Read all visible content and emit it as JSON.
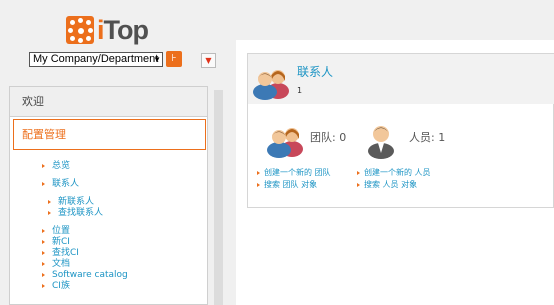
{
  "logo": {
    "mark_icon": "itop-logo-mark",
    "text_i": "i",
    "text_rest": "Top"
  },
  "org_selector": {
    "value": "My Company/Department",
    "icon": "chevron-down-icon"
  },
  "org_button": {
    "icon": "hierarchy-icon"
  },
  "pin_button": {
    "icon": "pin-icon"
  },
  "menu": {
    "welcome": "欢迎",
    "config": "配置管理",
    "items": [
      {
        "label": "总览"
      },
      {
        "label": "联系人"
      },
      {
        "label": "新联系人"
      },
      {
        "label": "查找联系人"
      },
      {
        "label": "位置"
      },
      {
        "label": "新CI"
      },
      {
        "label": "查找CI"
      },
      {
        "label": "文档"
      },
      {
        "label": "Software catalog"
      },
      {
        "label": "CI族"
      }
    ]
  },
  "card": {
    "title": "联系人",
    "count": "1",
    "teams_label": "团队: 0",
    "persons_label": "人员: 1",
    "links": [
      "创建一个新的 团队",
      "搜索 团队 对象",
      "创建一个新的 人员",
      "搜索 人员 对象"
    ]
  },
  "colors": {
    "accent": "#ec6f1c",
    "link": "#1c94c4"
  }
}
